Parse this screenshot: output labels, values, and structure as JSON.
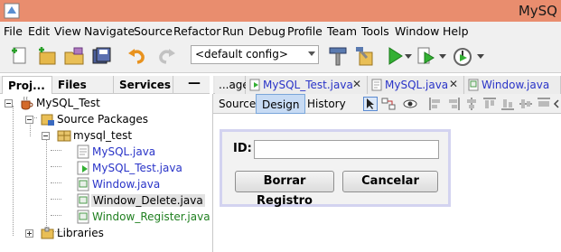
{
  "window": {
    "title": "MySQ"
  },
  "menu": [
    "File",
    "Edit",
    "View",
    "Navigate",
    "Source",
    "Refactor",
    "Run",
    "Debug",
    "Profile",
    "Team",
    "Tools",
    "Window",
    "Help"
  ],
  "toolbar": {
    "config_value": "<default config>",
    "icons": [
      "new-file-icon",
      "new-project-icon",
      "open-project-icon",
      "save-all-icon",
      "undo-icon",
      "redo-icon",
      "build-icon",
      "clean-build-icon",
      "run-icon",
      "debug-icon",
      "profile-icon"
    ]
  },
  "left_panel": {
    "tabs": [
      "Proj...",
      "Files",
      "Services"
    ],
    "minimize": "—",
    "tree": {
      "project": "MySQL_Test",
      "source_packages": "Source Packages",
      "package": "mysql_test",
      "files": [
        "MySQL.java",
        "MySQL_Test.java",
        "Window.java",
        "Window_Delete.java",
        "Window_Register.java"
      ],
      "libraries": "Libraries"
    }
  },
  "editor": {
    "tabs": [
      "...age",
      "MySQL_Test.java",
      "MySQL.java",
      "Window.java"
    ],
    "close": "✕",
    "views": [
      "Source",
      "Design",
      "History"
    ],
    "active_view": "Design"
  },
  "form": {
    "id_label": "ID:",
    "id_value": "",
    "delete_button": "Borrar Registro",
    "cancel_button": "Cancelar"
  },
  "colors": {
    "titlebar": "#e98d6e",
    "link_blue": "#2a34c8",
    "green_file": "#1f7f1f",
    "design_active": "#c7dbf4"
  }
}
